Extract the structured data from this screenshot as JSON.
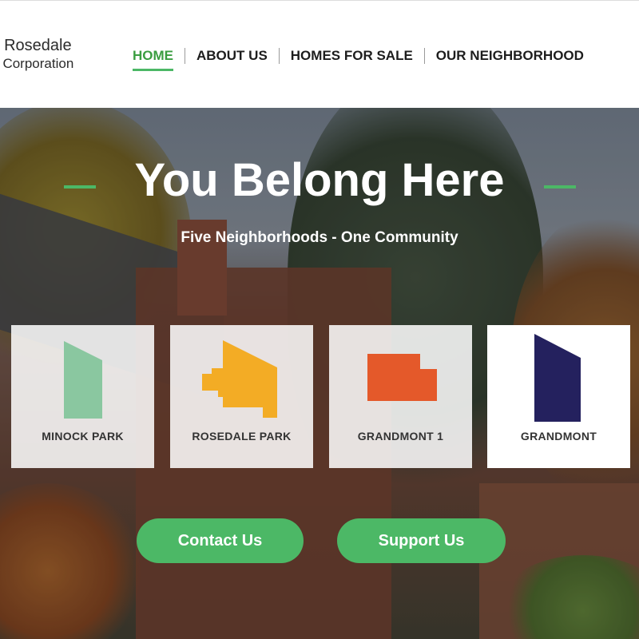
{
  "logo": {
    "line1": "t Rosedale",
    "line2": "t Corporation"
  },
  "nav": {
    "items": [
      {
        "label": "HOME",
        "active": true
      },
      {
        "label": "ABOUT US"
      },
      {
        "label": "HOMES FOR SALE"
      },
      {
        "label": "OUR NEIGHBORHOOD"
      }
    ]
  },
  "hero": {
    "title": "You Belong Here",
    "subtitle": "Five Neighborhoods - One Community"
  },
  "neighborhoods": [
    {
      "label": "MINOCK PARK",
      "color": "#8ac7a0"
    },
    {
      "label": "ROSEDALE PARK",
      "color": "#f3ac25"
    },
    {
      "label": "GRANDMONT 1",
      "color": "#e4592a"
    },
    {
      "label": "GRANDMONT",
      "color": "#24215e"
    }
  ],
  "buttons": {
    "contact": "Contact Us",
    "support": "Support Us"
  },
  "colors": {
    "accent": "#4cb866",
    "nav_active": "#3a9d40"
  }
}
